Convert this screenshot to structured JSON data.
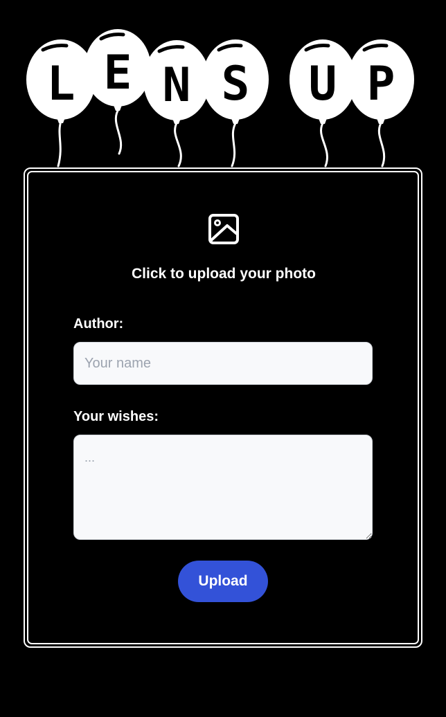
{
  "logo": {
    "letters": [
      "L",
      "E",
      "N",
      "S",
      "U",
      "P"
    ],
    "word1": "LENS",
    "word2": "UP"
  },
  "upload": {
    "icon": "image-icon",
    "prompt": "Click to upload your photo"
  },
  "form": {
    "author_label": "Author:",
    "author_placeholder": "Your name",
    "author_value": "",
    "wishes_label": "Your wishes:",
    "wishes_placeholder": "...",
    "wishes_value": "",
    "submit_label": "Upload"
  },
  "colors": {
    "background": "#000000",
    "foreground": "#ffffff",
    "button": "#3352d8",
    "input_background": "#f8f9fb",
    "placeholder": "#9ca3af"
  }
}
